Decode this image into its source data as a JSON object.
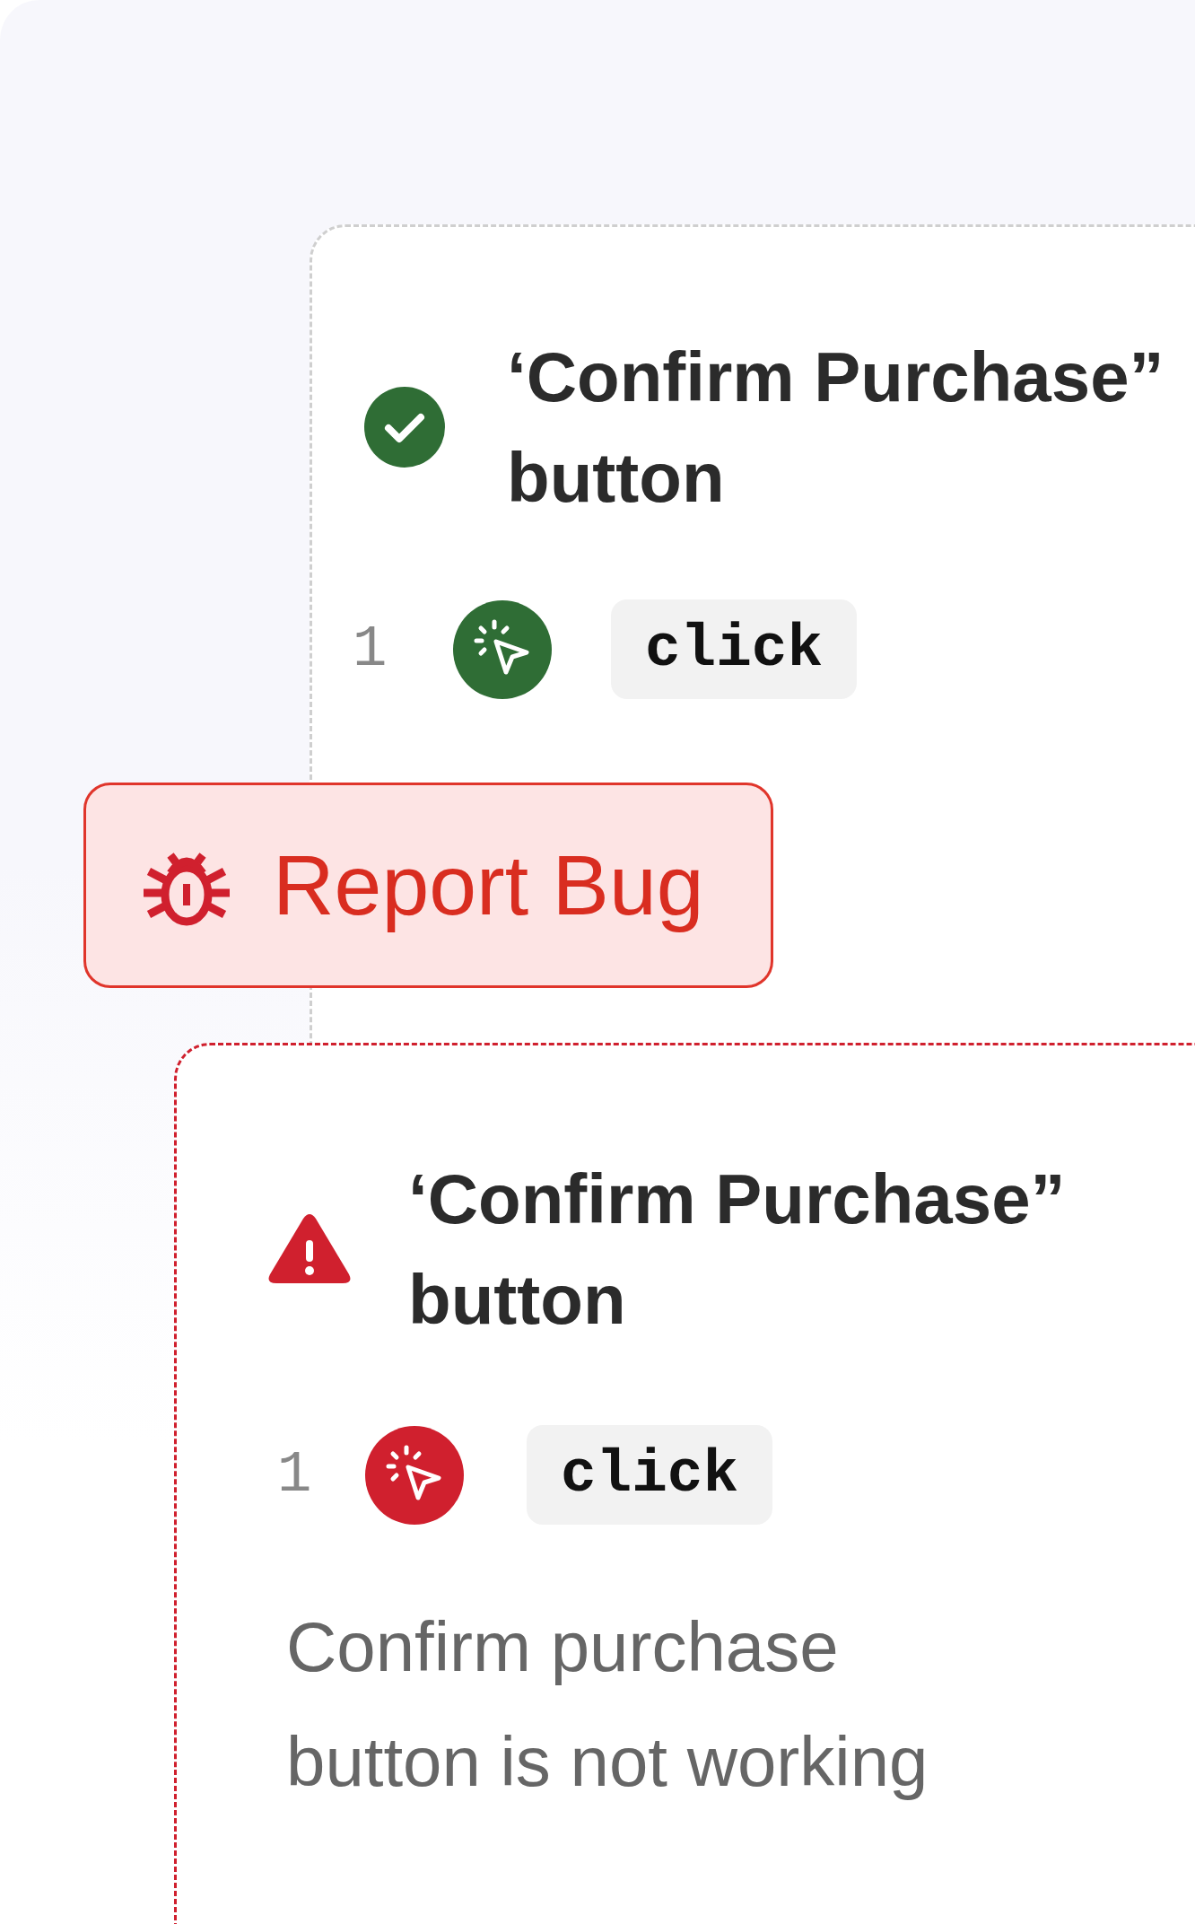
{
  "cards": [
    {
      "kind": "passed",
      "title": "‘Confirm Purchase” button",
      "steps": [
        {
          "number": "1",
          "action": "click"
        }
      ]
    },
    {
      "kind": "failed",
      "title": "‘Confirm Purchase” button",
      "steps": [
        {
          "number": "1",
          "action": "click"
        }
      ],
      "description": "Confirm purchase button is not working"
    }
  ],
  "report_button": {
    "label": "Report Bug"
  }
}
